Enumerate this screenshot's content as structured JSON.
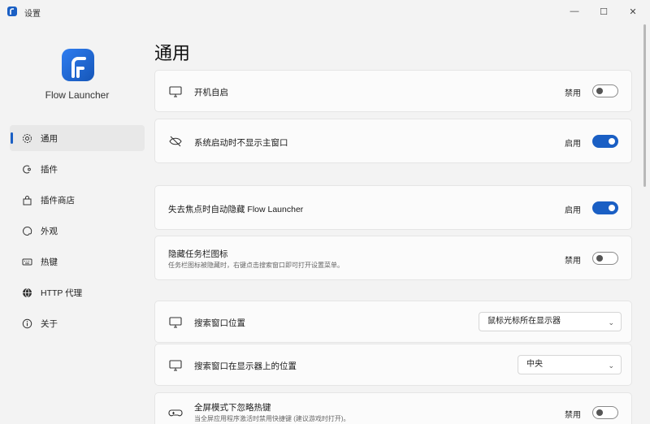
{
  "window": {
    "title": "设置",
    "minimize": "—",
    "maximize": "☐",
    "close": "✕"
  },
  "app": {
    "name": "Flow Launcher"
  },
  "sidebar": {
    "items": [
      {
        "label": "通用",
        "icon": "gear-icon"
      },
      {
        "label": "插件",
        "icon": "plugin-icon"
      },
      {
        "label": "插件商店",
        "icon": "store-icon"
      },
      {
        "label": "外观",
        "icon": "palette-icon"
      },
      {
        "label": "热键",
        "icon": "keyboard-icon"
      },
      {
        "label": "HTTP 代理",
        "icon": "globe-icon"
      },
      {
        "label": "关于",
        "icon": "info-icon"
      }
    ]
  },
  "main": {
    "title": "通用",
    "settings": [
      {
        "label": "开机自启",
        "state": "禁用",
        "on": false
      },
      {
        "label": "系统启动时不显示主窗口",
        "state": "启用",
        "on": true
      },
      {
        "label": "失去焦点时自动隐藏 Flow Launcher",
        "state": "启用",
        "on": true
      },
      {
        "label": "隐藏任务栏图标",
        "sub": "任务栏图标被隐藏时，右键点击搜索窗口即可打开设置菜单。",
        "state": "禁用",
        "on": false
      },
      {
        "label": "搜索窗口位置",
        "select": "鼠标光标所在显示器"
      },
      {
        "label": "搜索窗口在显示器上的位置",
        "select": "中央"
      },
      {
        "label": "全屏模式下忽略热键",
        "sub": "当全屏应用程序激活时禁用快捷键 (建议游戏时打开)。",
        "state": "禁用",
        "on": false
      }
    ]
  },
  "colors": {
    "accent": "#1a5fc4",
    "background": "#f3f3f3",
    "card": "#fbfbfb"
  }
}
